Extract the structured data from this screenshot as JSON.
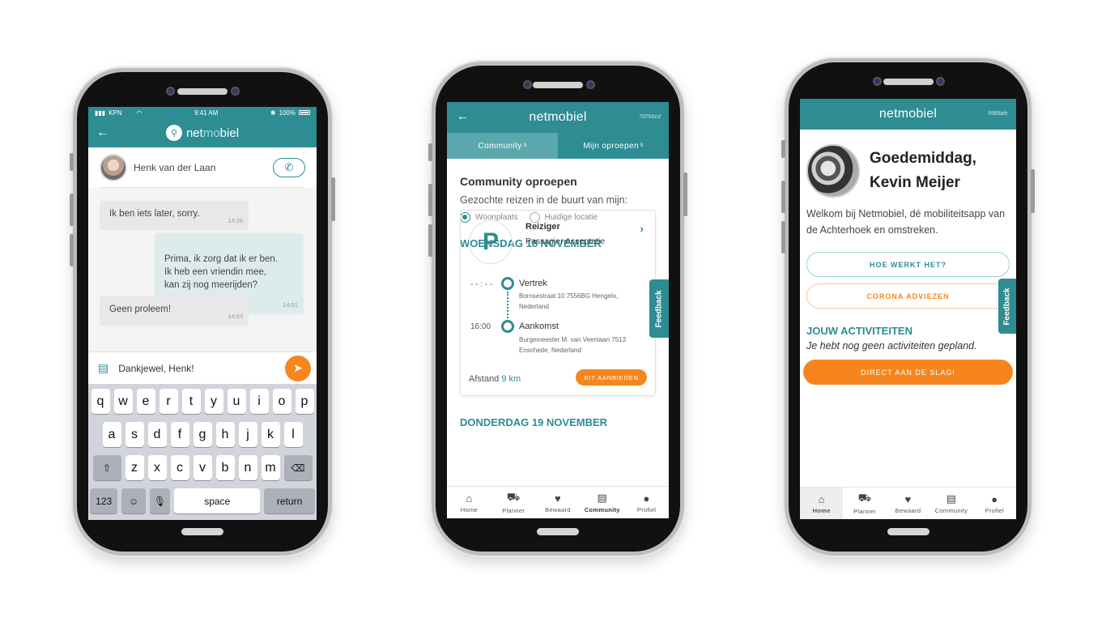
{
  "phone1": {
    "status": {
      "carrier": "KPN",
      "time": "9:41 AM",
      "battery": "100%"
    },
    "logo_pre": "net",
    "logo_mid": "mo",
    "logo_post": "biel",
    "contact_name": "Henk van der Laan",
    "messages": [
      {
        "text": "Ik ben iets later, sorry.",
        "time": "14:26",
        "dir": "in"
      },
      {
        "text": "Prima, ik zorg dat ik er ben.\nIk heb een vriendin mee,\nkan zij nog meerijden?",
        "time": "14:51",
        "dir": "out"
      },
      {
        "text": "Geen proleem!",
        "time": "14:53",
        "dir": "in"
      }
    ],
    "input_text": "Dankjewel, Henk!",
    "keyboard": {
      "row1": [
        "q",
        "w",
        "e",
        "r",
        "t",
        "y",
        "u",
        "i",
        "o",
        "p"
      ],
      "row2": [
        "a",
        "s",
        "d",
        "f",
        "g",
        "h",
        "j",
        "k",
        "l"
      ],
      "row3": [
        "z",
        "x",
        "c",
        "v",
        "b",
        "n",
        "m"
      ],
      "num_label": "123",
      "space_label": "space",
      "return_label": "return"
    }
  },
  "phone2": {
    "app_title": "netmobiel",
    "device_code": "7d7b6cd",
    "tabs": [
      {
        "label": "Community",
        "count": "3"
      },
      {
        "label": "Mijn oproepen",
        "count": "0"
      }
    ],
    "heading": "Community oproepen",
    "subheading": "Gezochte reizen in de buurt van mijn:",
    "radio_options": [
      "Woonplaats",
      "Huidige locatie"
    ],
    "day1": "WOENSDAG 18 NOVEMBER",
    "trip": {
      "badge": "P",
      "role": "Reiziger",
      "status": "Passagier Acceptatie",
      "departure_time": "- - : - -",
      "departure_label": "Vertrek",
      "departure_address": "Bornsestraat 10 7556BG Hengelo, Nederland",
      "arrival_time": "16:00",
      "arrival_label": "Aankomst",
      "arrival_address": "Burgemeester M. van Veenlaan 7513 Enschede, Nederland",
      "distance_label": "Afstand",
      "distance_value": "9 km",
      "offer_label": "RIT AANBIEDEN"
    },
    "day2": "DONDERDAG 19 NOVEMBER",
    "feedback_label": "Feedback"
  },
  "phone3": {
    "app_title": "netmobiel",
    "device_code": "9985afc",
    "greeting_line1": "Goedemiddag,",
    "greeting_line2": "Kevin Meijer",
    "welcome_text": "Welkom bij Netmobiel, dé mobiliteitsapp van de Achterhoek en omstreken.",
    "how_label": "HOE WERKT HET?",
    "corona_label": "CORONA ADVIEZEN",
    "activities_heading": "JOUW ACTIVITEITEN",
    "activities_empty": "Je hebt nog geen activiteiten gepland.",
    "cta_label": "DIRECT AAN DE SLAG!",
    "feedback_label": "Feedback"
  },
  "nav": [
    "Home",
    "Planner",
    "Bewaard",
    "Community",
    "Profiel"
  ],
  "colors": {
    "primary": "#2e8c93",
    "accent": "#f7851e"
  }
}
